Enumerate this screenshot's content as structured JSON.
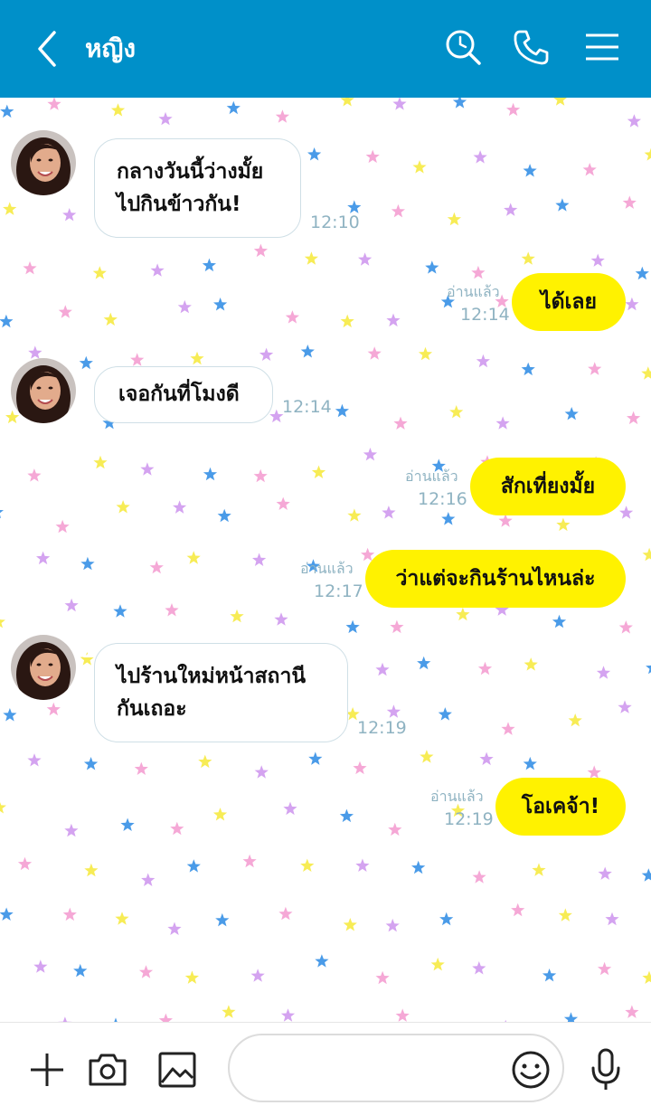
{
  "header": {
    "title": "หญิง",
    "back_icon": "chevron-left-icon",
    "icons": [
      "search-clock-icon",
      "phone-icon",
      "menu-icon"
    ],
    "bg_color": "#0090c9"
  },
  "messages": [
    {
      "side": "in",
      "text": "กลางวันนี้ว่างมั้ย\nไปกินข้าวกัน!",
      "time": "12:10"
    },
    {
      "side": "out",
      "text": "ได้เลย",
      "read": "อ่านแล้ว",
      "time": "12:14"
    },
    {
      "side": "in",
      "text": "เจอกันที่โมงดี",
      "time": "12:14"
    },
    {
      "side": "out",
      "text": "สักเที่ยงมั้ย",
      "read": "อ่านแล้ว",
      "time": "12:16"
    },
    {
      "side": "out",
      "text": "ว่าแต่จะกินร้านไหนล่ะ",
      "read": "อ่านแล้ว",
      "time": "12:17"
    },
    {
      "side": "in",
      "text": "ไปร้านใหม่หน้าสถานี\nกันเถอะ",
      "time": "12:19"
    },
    {
      "side": "out",
      "text": "โอเคจ้า!",
      "read": "อ่านแล้ว",
      "time": "12:19"
    }
  ],
  "footer": {
    "icons": [
      "plus-icon",
      "camera-icon",
      "image-icon",
      "emoji-icon",
      "microphone-icon"
    ],
    "input_value": ""
  },
  "colors": {
    "outgoing_bubble": "#fff200",
    "incoming_bubble": "#ffffff",
    "star_blue": "#4a9be8",
    "star_pink": "#f5a8d6",
    "star_yellow": "#f7ec55",
    "star_purple": "#d4a3f0"
  }
}
